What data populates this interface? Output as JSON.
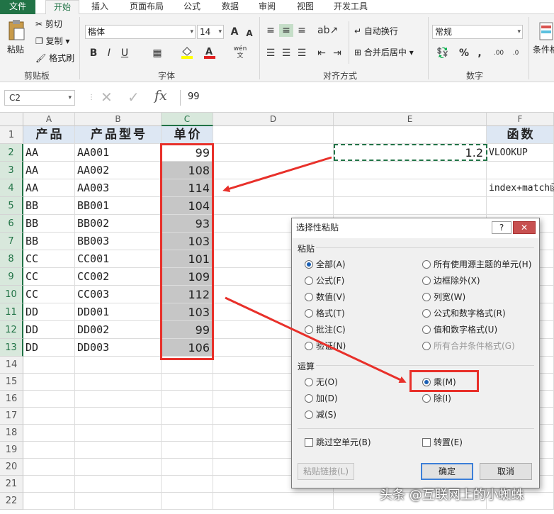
{
  "ribbon": {
    "tabs": [
      "文件",
      "开始",
      "插入",
      "页面布局",
      "公式",
      "数据",
      "审阅",
      "视图",
      "开发工具"
    ],
    "active_tab": "开始",
    "clipboard": {
      "paste": "粘贴",
      "cut": "剪切",
      "copy": "复制",
      "format_painter": "格式刷",
      "label": "剪贴板"
    },
    "font": {
      "name": "楷体",
      "size": "14",
      "label": "字体",
      "bold": "B",
      "italic": "I",
      "underline": "U",
      "grow": "A",
      "shrink": "A",
      "phonetic": "wén"
    },
    "alignment": {
      "wrap": "自动换行",
      "merge": "合并后居中",
      "label": "对齐方式"
    },
    "number": {
      "format": "常规",
      "label": "数字",
      "percent": "%",
      "comma": ",",
      "inc_dec": ".00",
      "dec_dec": ".0"
    },
    "styles": {
      "conditional": "条件格"
    }
  },
  "formula_bar": {
    "name_box": "C2",
    "cancel": "✕",
    "enter": "✓",
    "fx": "fx",
    "value": "99"
  },
  "grid": {
    "columns": [
      "A",
      "B",
      "C",
      "D",
      "E",
      "F"
    ],
    "rows": [
      "1",
      "2",
      "3",
      "4",
      "5",
      "6",
      "7",
      "8",
      "9",
      "10",
      "11",
      "12",
      "13",
      "14",
      "15",
      "16",
      "17",
      "18",
      "19",
      "20",
      "21",
      "22"
    ],
    "header_row": {
      "A": "产品",
      "B": "产品型号",
      "C": "单价",
      "F": "函数"
    },
    "data": [
      {
        "A": "AA",
        "B": "AA001",
        "C": "99"
      },
      {
        "A": "AA",
        "B": "AA002",
        "C": "108"
      },
      {
        "A": "AA",
        "B": "AA003",
        "C": "114"
      },
      {
        "A": "BB",
        "B": "BB001",
        "C": "104"
      },
      {
        "A": "BB",
        "B": "BB002",
        "C": "93"
      },
      {
        "A": "BB",
        "B": "BB003",
        "C": "103"
      },
      {
        "A": "CC",
        "B": "CC001",
        "C": "101"
      },
      {
        "A": "CC",
        "B": "CC002",
        "C": "109"
      },
      {
        "A": "CC",
        "B": "CC003",
        "C": "112"
      },
      {
        "A": "DD",
        "B": "DD001",
        "C": "103"
      },
      {
        "A": "DD",
        "B": "DD002",
        "C": "99"
      },
      {
        "A": "DD",
        "B": "DD003",
        "C": "106"
      }
    ],
    "E2": "1.2",
    "F2": "VLOOKUP",
    "F4": "index+match函"
  },
  "dialog": {
    "title": "选择性粘贴",
    "help": "?",
    "close": "✕",
    "paste_section": "粘贴",
    "paste_left": [
      "全部(A)",
      "公式(F)",
      "数值(V)",
      "格式(T)",
      "批注(C)",
      "验证(N)"
    ],
    "paste_right": [
      "所有使用源主题的单元(H)",
      "边框除外(X)",
      "列宽(W)",
      "公式和数字格式(R)",
      "值和数字格式(U)",
      "所有合并条件格式(G)"
    ],
    "op_section": "运算",
    "op_left": [
      "无(O)",
      "加(D)",
      "减(S)"
    ],
    "op_right": [
      "乘(M)",
      "除(I)"
    ],
    "skip_blanks": "跳过空单元(B)",
    "transpose": "转置(E)",
    "paste_link": "粘贴链接(L)",
    "ok": "确定",
    "cancel": "取消"
  },
  "colors": {
    "excel_green": "#217346",
    "highlight_red": "#e8302a",
    "marching_ants": "#217346"
  },
  "watermark": "头条 @互联网上的小蜘蛛"
}
